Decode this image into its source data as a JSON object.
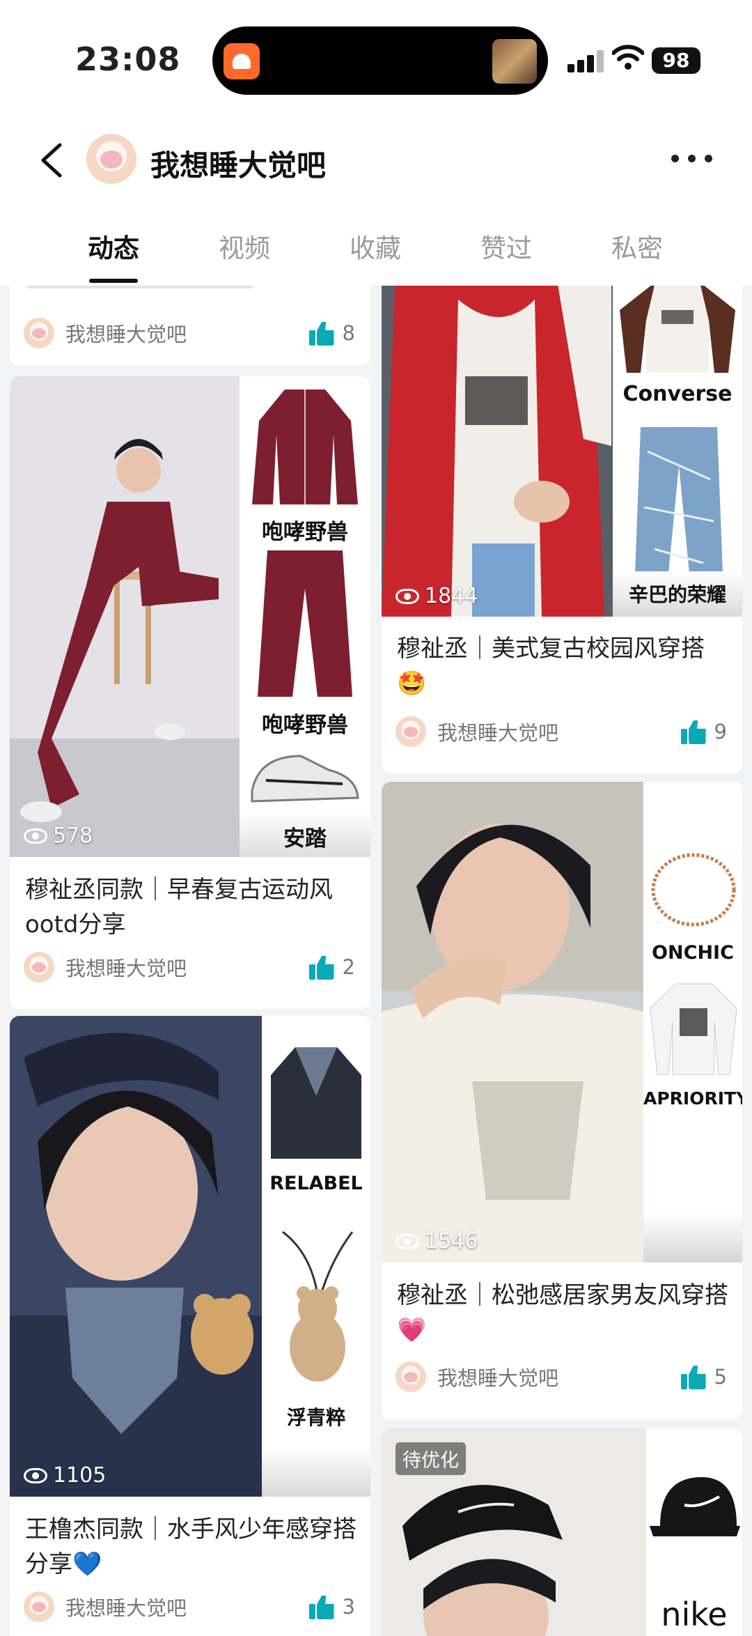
{
  "status_bar": {
    "time": "23:08",
    "battery": "98"
  },
  "header": {
    "title": "我想睡大觉吧"
  },
  "tabs": [
    {
      "label": "动态",
      "active": true
    },
    {
      "label": "视频",
      "active": false
    },
    {
      "label": "收藏",
      "active": false
    },
    {
      "label": "赞过",
      "active": false
    },
    {
      "label": "私密",
      "active": false
    }
  ],
  "feed": {
    "left": [
      {
        "title": "",
        "author": "我想睡大觉吧",
        "likes": "8"
      },
      {
        "views": "578",
        "brands": [
          "咆哮野兽",
          "咆哮野兽",
          "安踏"
        ],
        "title": "穆祉丞同款｜早春复古运动风ootd分享",
        "author": "我想睡大觉吧",
        "likes": "2"
      },
      {
        "views": "1105",
        "brands": [
          "RELABEL",
          "浮青粹"
        ],
        "title": "王橹杰同款｜水手风少年感穿搭分享💙",
        "author": "我想睡大觉吧",
        "likes": "3"
      }
    ],
    "right": [
      {
        "views": "1844",
        "brands": [
          "Converse",
          "辛巴的荣耀"
        ],
        "title": "穆祉丞｜美式复古校园风穿搭🤩",
        "author": "我想睡大觉吧",
        "likes": "9"
      },
      {
        "views": "1546",
        "brands": [
          "ONCHIC",
          "APRIORITY"
        ],
        "title": "穆祉丞｜松弛感居家男友风穿搭💗",
        "author": "我想睡大觉吧",
        "likes": "5"
      },
      {
        "badge": "待优化",
        "brands": [
          "nike"
        ]
      }
    ]
  },
  "colors": {
    "accent_like": "#0aa9b6",
    "jacket_red": "#c8262c",
    "burgundy": "#7d1f2e"
  }
}
